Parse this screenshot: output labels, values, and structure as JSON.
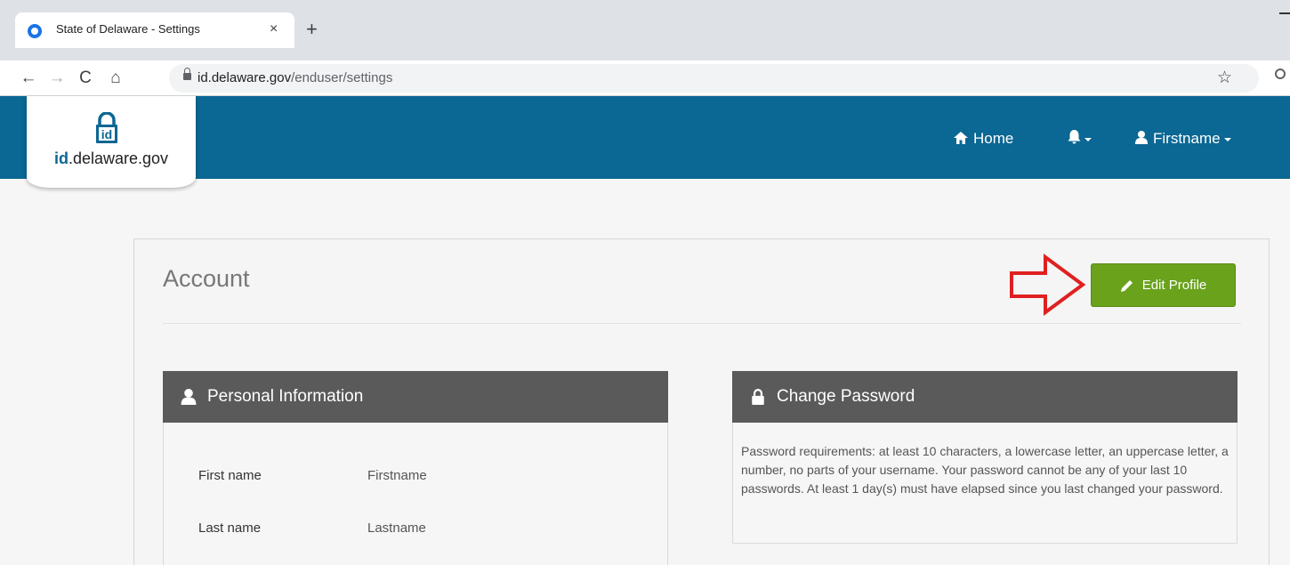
{
  "browser": {
    "tab_title": "State of Delaware - Settings",
    "tab_close": "×",
    "new_tab": "+",
    "url_host": "id.delaware.gov",
    "url_path": "/enduser/settings",
    "nav_back": "←",
    "nav_forward": "→",
    "nav_reload": "C",
    "nav_home": "⌂",
    "bookmark_star": "☆"
  },
  "header": {
    "logo_id": "id",
    "logo_rest": ".delaware.gov",
    "home_label": "Home",
    "user_label": "Firstname",
    "accent_color": "#0b6793"
  },
  "account": {
    "title": "Account",
    "edit_button_label": "Edit Profile",
    "edit_button_color": "#6aa21c",
    "annotation_arrow_color": "#e02020"
  },
  "personal_info": {
    "heading": "Personal Information",
    "fields": [
      {
        "label": "First name",
        "value": "Firstname"
      },
      {
        "label": "Last name",
        "value": "Lastname"
      }
    ]
  },
  "change_password": {
    "heading": "Change Password",
    "requirements": "Password requirements: at least 10 characters, a lowercase letter, an uppercase letter, a number, no parts of your username. Your password cannot be any of your last 10 passwords. At least 1 day(s) must have elapsed since you last changed your password."
  }
}
